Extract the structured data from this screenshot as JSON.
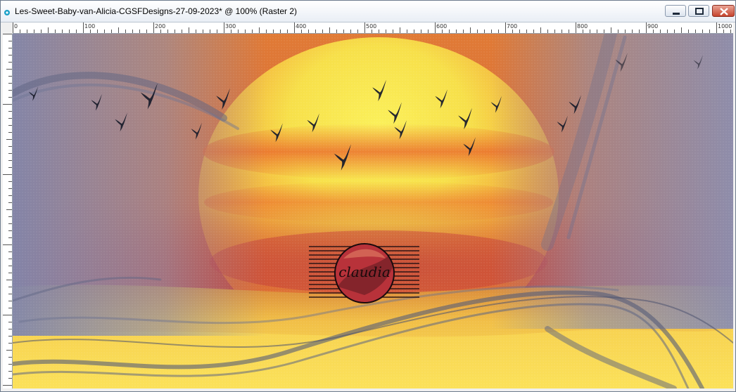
{
  "window": {
    "title": "Les-Sweet-Baby-van-Alicia-CGSFDesigns-27-09-2023* @ 100% (Raster 2)",
    "buttons": {
      "minimize": "minimize-icon",
      "maximize": "maximize-icon",
      "close": "close-icon"
    }
  },
  "ruler": {
    "labels": [
      "0",
      "100",
      "200",
      "300",
      "400",
      "500",
      "600",
      "700",
      "800",
      "900",
      "1000"
    ]
  },
  "canvas": {
    "watermark": "claudia"
  },
  "colors": {
    "sky_top": "#e2813a",
    "sun_center": "#f7e84a",
    "sun_band": "#e9632a",
    "haze": "#8c8fae",
    "water": "#f6c94a",
    "bird": "#1a1e2c"
  }
}
